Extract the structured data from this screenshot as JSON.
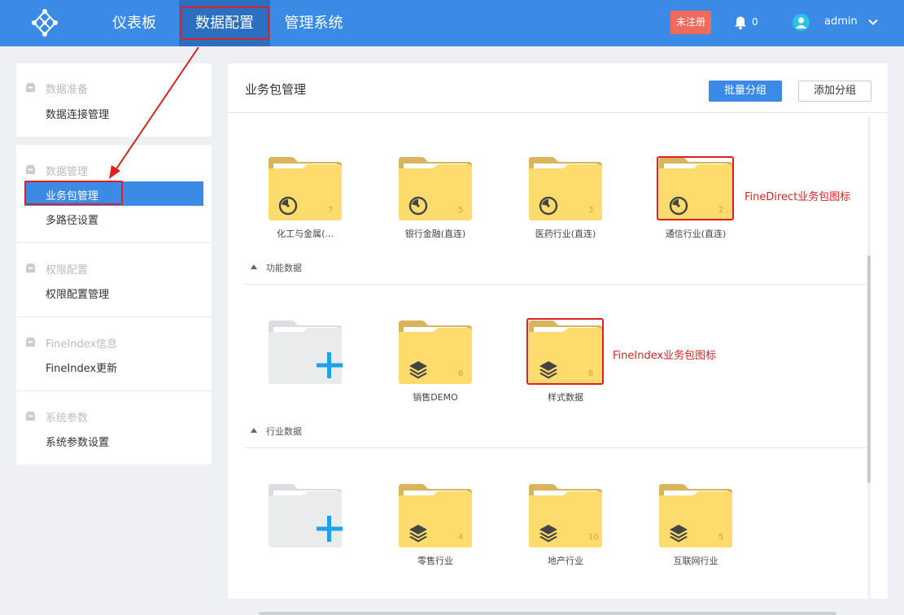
{
  "topbar": {
    "nav": [
      "仪表板",
      "数据配置",
      "管理系统"
    ],
    "unregistered": "未注册",
    "notification_count": "0",
    "username": "admin"
  },
  "sidebar": {
    "groups": [
      {
        "category": "数据准备",
        "items": [
          "数据连接管理"
        ]
      },
      {
        "category": "数据管理",
        "items": [
          "业务包管理",
          "多路径设置"
        ]
      },
      {
        "category": "权限配置",
        "items": [
          "权限配置管理"
        ]
      },
      {
        "category": "FineIndex信息",
        "items": [
          "FineIndex更新"
        ]
      },
      {
        "category": "系统参数",
        "items": [
          "系统参数设置"
        ]
      }
    ]
  },
  "main": {
    "title": "业务包管理",
    "batch_group_button": "批量分组",
    "add_group_button": "添加分组",
    "group1": {
      "packages": [
        {
          "name": "化工与金属(...",
          "count": "7",
          "type": "direct"
        },
        {
          "name": "银行金融(直连)",
          "count": "5",
          "type": "direct"
        },
        {
          "name": "医药行业(直连)",
          "count": "3",
          "type": "direct"
        },
        {
          "name": "通信行业(直连)",
          "count": "2",
          "type": "direct"
        }
      ]
    },
    "group2": {
      "title": "功能数据",
      "packages": [
        {
          "name": "销售DEMO",
          "count": "6",
          "type": "index"
        },
        {
          "name": "样式数据",
          "count": "8",
          "type": "index"
        }
      ]
    },
    "group3": {
      "title": "行业数据",
      "packages": [
        {
          "name": "零售行业",
          "count": "4",
          "type": "index"
        },
        {
          "name": "地产行业",
          "count": "10",
          "type": "index"
        },
        {
          "name": "互联网行业",
          "count": "5",
          "type": "index"
        }
      ]
    }
  },
  "annotations": {
    "finedirect": "FineDirect业务包图标",
    "fineindex": "FineIndex业务包图标"
  },
  "colors": {
    "primary": "#3b8ae6",
    "nav_active": "#2c6fc0",
    "unregistered": "#f06a5e",
    "folder": "#fddb6d",
    "folder_back": "#d9b45a",
    "count": "#ee9c2d",
    "highlight": "#e02020"
  }
}
